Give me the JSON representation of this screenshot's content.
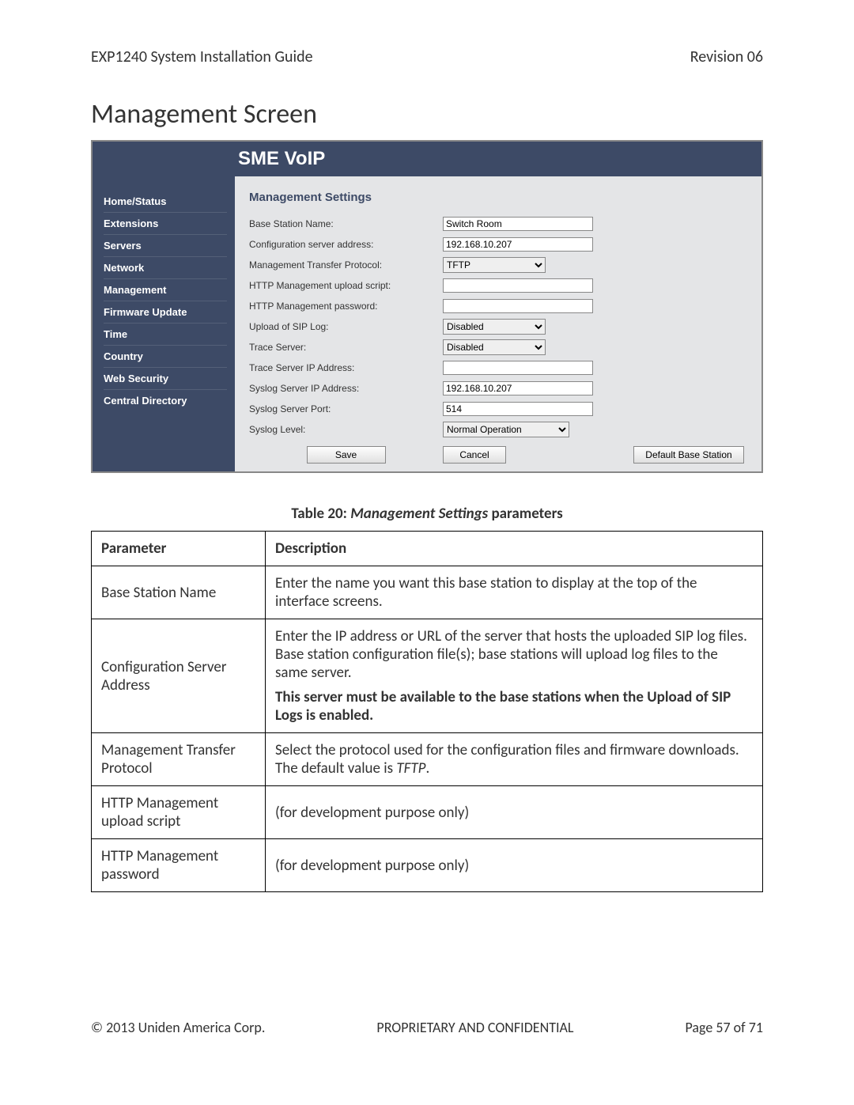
{
  "header": {
    "left": "EXP1240 System Installation Guide",
    "right": "Revision 06"
  },
  "section_title": "Management Screen",
  "screenshot": {
    "banner_title": "SME VoIP",
    "content_title": "Management Settings",
    "sidebar": {
      "items": [
        {
          "label": "Home/Status"
        },
        {
          "label": "Extensions"
        },
        {
          "label": "Servers"
        },
        {
          "label": "Network"
        },
        {
          "label": "Management"
        },
        {
          "label": "Firmware Update"
        },
        {
          "label": "Time"
        },
        {
          "label": "Country"
        },
        {
          "label": "Web Security"
        },
        {
          "label": "Central Directory"
        }
      ]
    },
    "fields": {
      "base_station_name": {
        "label": "Base Station Name:",
        "value": "Switch Room"
      },
      "config_server_address": {
        "label": "Configuration server address:",
        "value": "192.168.10.207"
      },
      "mgmt_transfer_protocol": {
        "label": "Management Transfer Protocol:",
        "value": "TFTP"
      },
      "http_upload_script": {
        "label": "HTTP Management upload script:",
        "value": ""
      },
      "http_mgmt_password": {
        "label": "HTTP Management password:",
        "value": ""
      },
      "upload_sip_log": {
        "label": "Upload of SIP Log:",
        "value": "Disabled"
      },
      "trace_server": {
        "label": "Trace Server:",
        "value": "Disabled"
      },
      "trace_server_ip": {
        "label": "Trace Server IP Address:",
        "value": ""
      },
      "syslog_server_ip": {
        "label": "Syslog Server IP Address:",
        "value": "192.168.10.207"
      },
      "syslog_server_port": {
        "label": "Syslog Server Port:",
        "value": "514"
      },
      "syslog_level": {
        "label": "Syslog Level:",
        "value": "Normal Operation"
      }
    },
    "buttons": {
      "save": "Save",
      "cancel": "Cancel",
      "default": "Default Base Station"
    }
  },
  "table_caption": {
    "prefix": "Table 20: ",
    "italic": "Management Settings",
    "suffix": " parameters"
  },
  "table": {
    "headers": {
      "param": "Parameter",
      "desc": "Description"
    },
    "rows": [
      {
        "param": "Base Station Name",
        "desc": "Enter the name you want this base station to display at the top of the interface screens."
      },
      {
        "param": "Configuration Server Address",
        "desc": "Enter the IP address or URL of the server that hosts the uploaded SIP log files. Base station configuration file(s); base stations will upload log files to the same server.",
        "bold": "This server must be available to the base stations when the Upload of SIP Logs is enabled."
      },
      {
        "param": "Management Transfer Protocol",
        "desc": "Select the protocol used for the configuration files and firmware downloads. The default value is ",
        "italic_tail": "TFTP",
        "tail": "."
      },
      {
        "param": "HTTP Management upload script",
        "desc": "(for development purpose only)"
      },
      {
        "param": "HTTP Management password",
        "desc": "(for development purpose only)"
      }
    ]
  },
  "footer": {
    "left": "© 2013 Uniden America Corp.",
    "center": "PROPRIETARY AND CONFIDENTIAL",
    "right": "Page 57 of 71"
  }
}
